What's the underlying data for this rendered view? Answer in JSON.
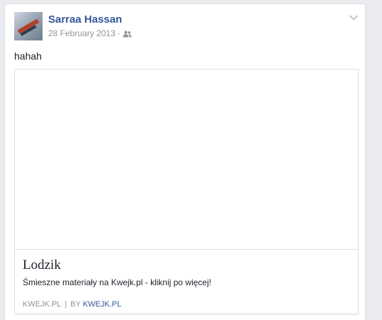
{
  "post": {
    "author": "Sarraa Hassan",
    "date": "28 February 2013",
    "separator": "·",
    "audience_icon": "friends-icon",
    "options_icon": "chevron-down-icon",
    "text": "hahah"
  },
  "attachment": {
    "title": "Lodzik",
    "description": "Śmieszne materiały na Kwejk.pl - kliknij po więcej!",
    "domain": "KWEJK.PL",
    "pipe": "|",
    "by_label": "BY",
    "by_name": "KWEJK.PL"
  },
  "colors": {
    "link": "#365899",
    "muted": "#90949c",
    "text": "#1d2129",
    "border": "#dddfe2",
    "background": "#e9ebee"
  }
}
